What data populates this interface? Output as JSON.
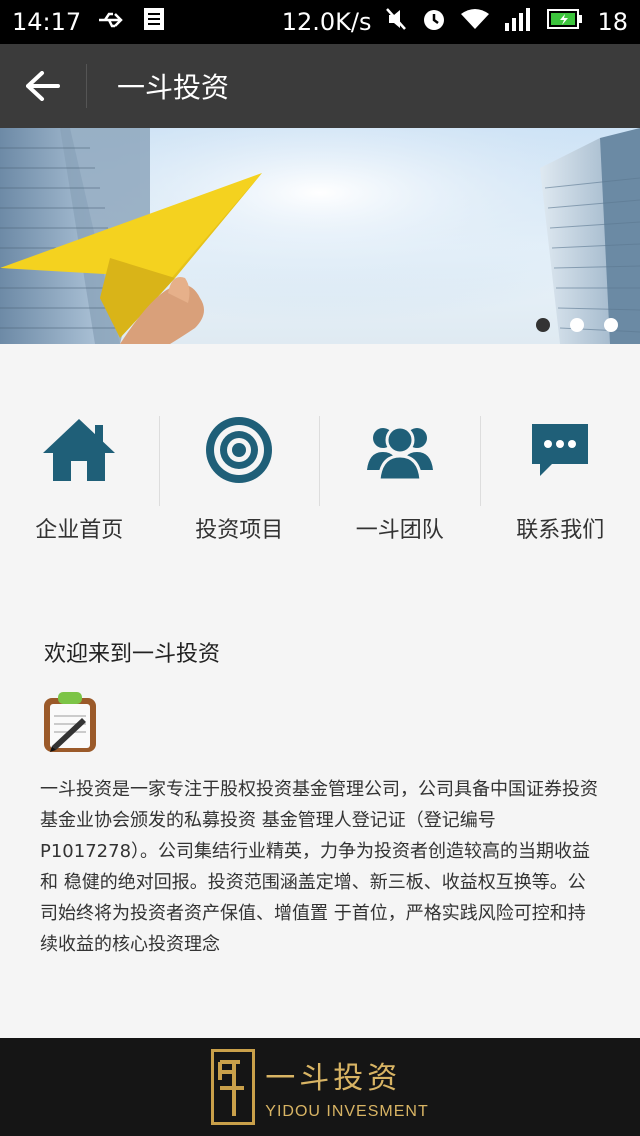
{
  "status_bar": {
    "time": "14:17",
    "speed": "12.0K/s",
    "network": "3G",
    "battery_level": "18"
  },
  "app_bar": {
    "title": "一斗投资"
  },
  "banner": {
    "slide_count": 3,
    "active_slide": 1
  },
  "nav": {
    "items": [
      {
        "label": "企业首页",
        "icon": "home-icon"
      },
      {
        "label": "投资项目",
        "icon": "target-icon"
      },
      {
        "label": "一斗团队",
        "icon": "team-icon"
      },
      {
        "label": "联系我们",
        "icon": "chat-icon"
      }
    ]
  },
  "welcome": {
    "heading": "欢迎来到一斗投资",
    "body": "一斗投资是一家专注于股权投资基金管理公司，公司具备中国证券投资基金业协会颁发的私募投资 基金管理人登记证（登记编号P1017278）。公司集结行业精英，力争为投资者创造较高的当期收益和 稳健的绝对回报。投资范围涵盖定增、新三板、收益权互换等。公司始终将为投资者资产保值、增值置 于首位，严格实践风险可控和持续收益的核心投资理念"
  },
  "footer": {
    "logo_cn": "一斗投资",
    "logo_en": "YIDOU INVESMENT"
  },
  "colors": {
    "icon_teal": "#1f5f78",
    "appbar_bg": "#3b3b3b",
    "footer_bg": "#151515",
    "gold": "#c9a04a"
  }
}
